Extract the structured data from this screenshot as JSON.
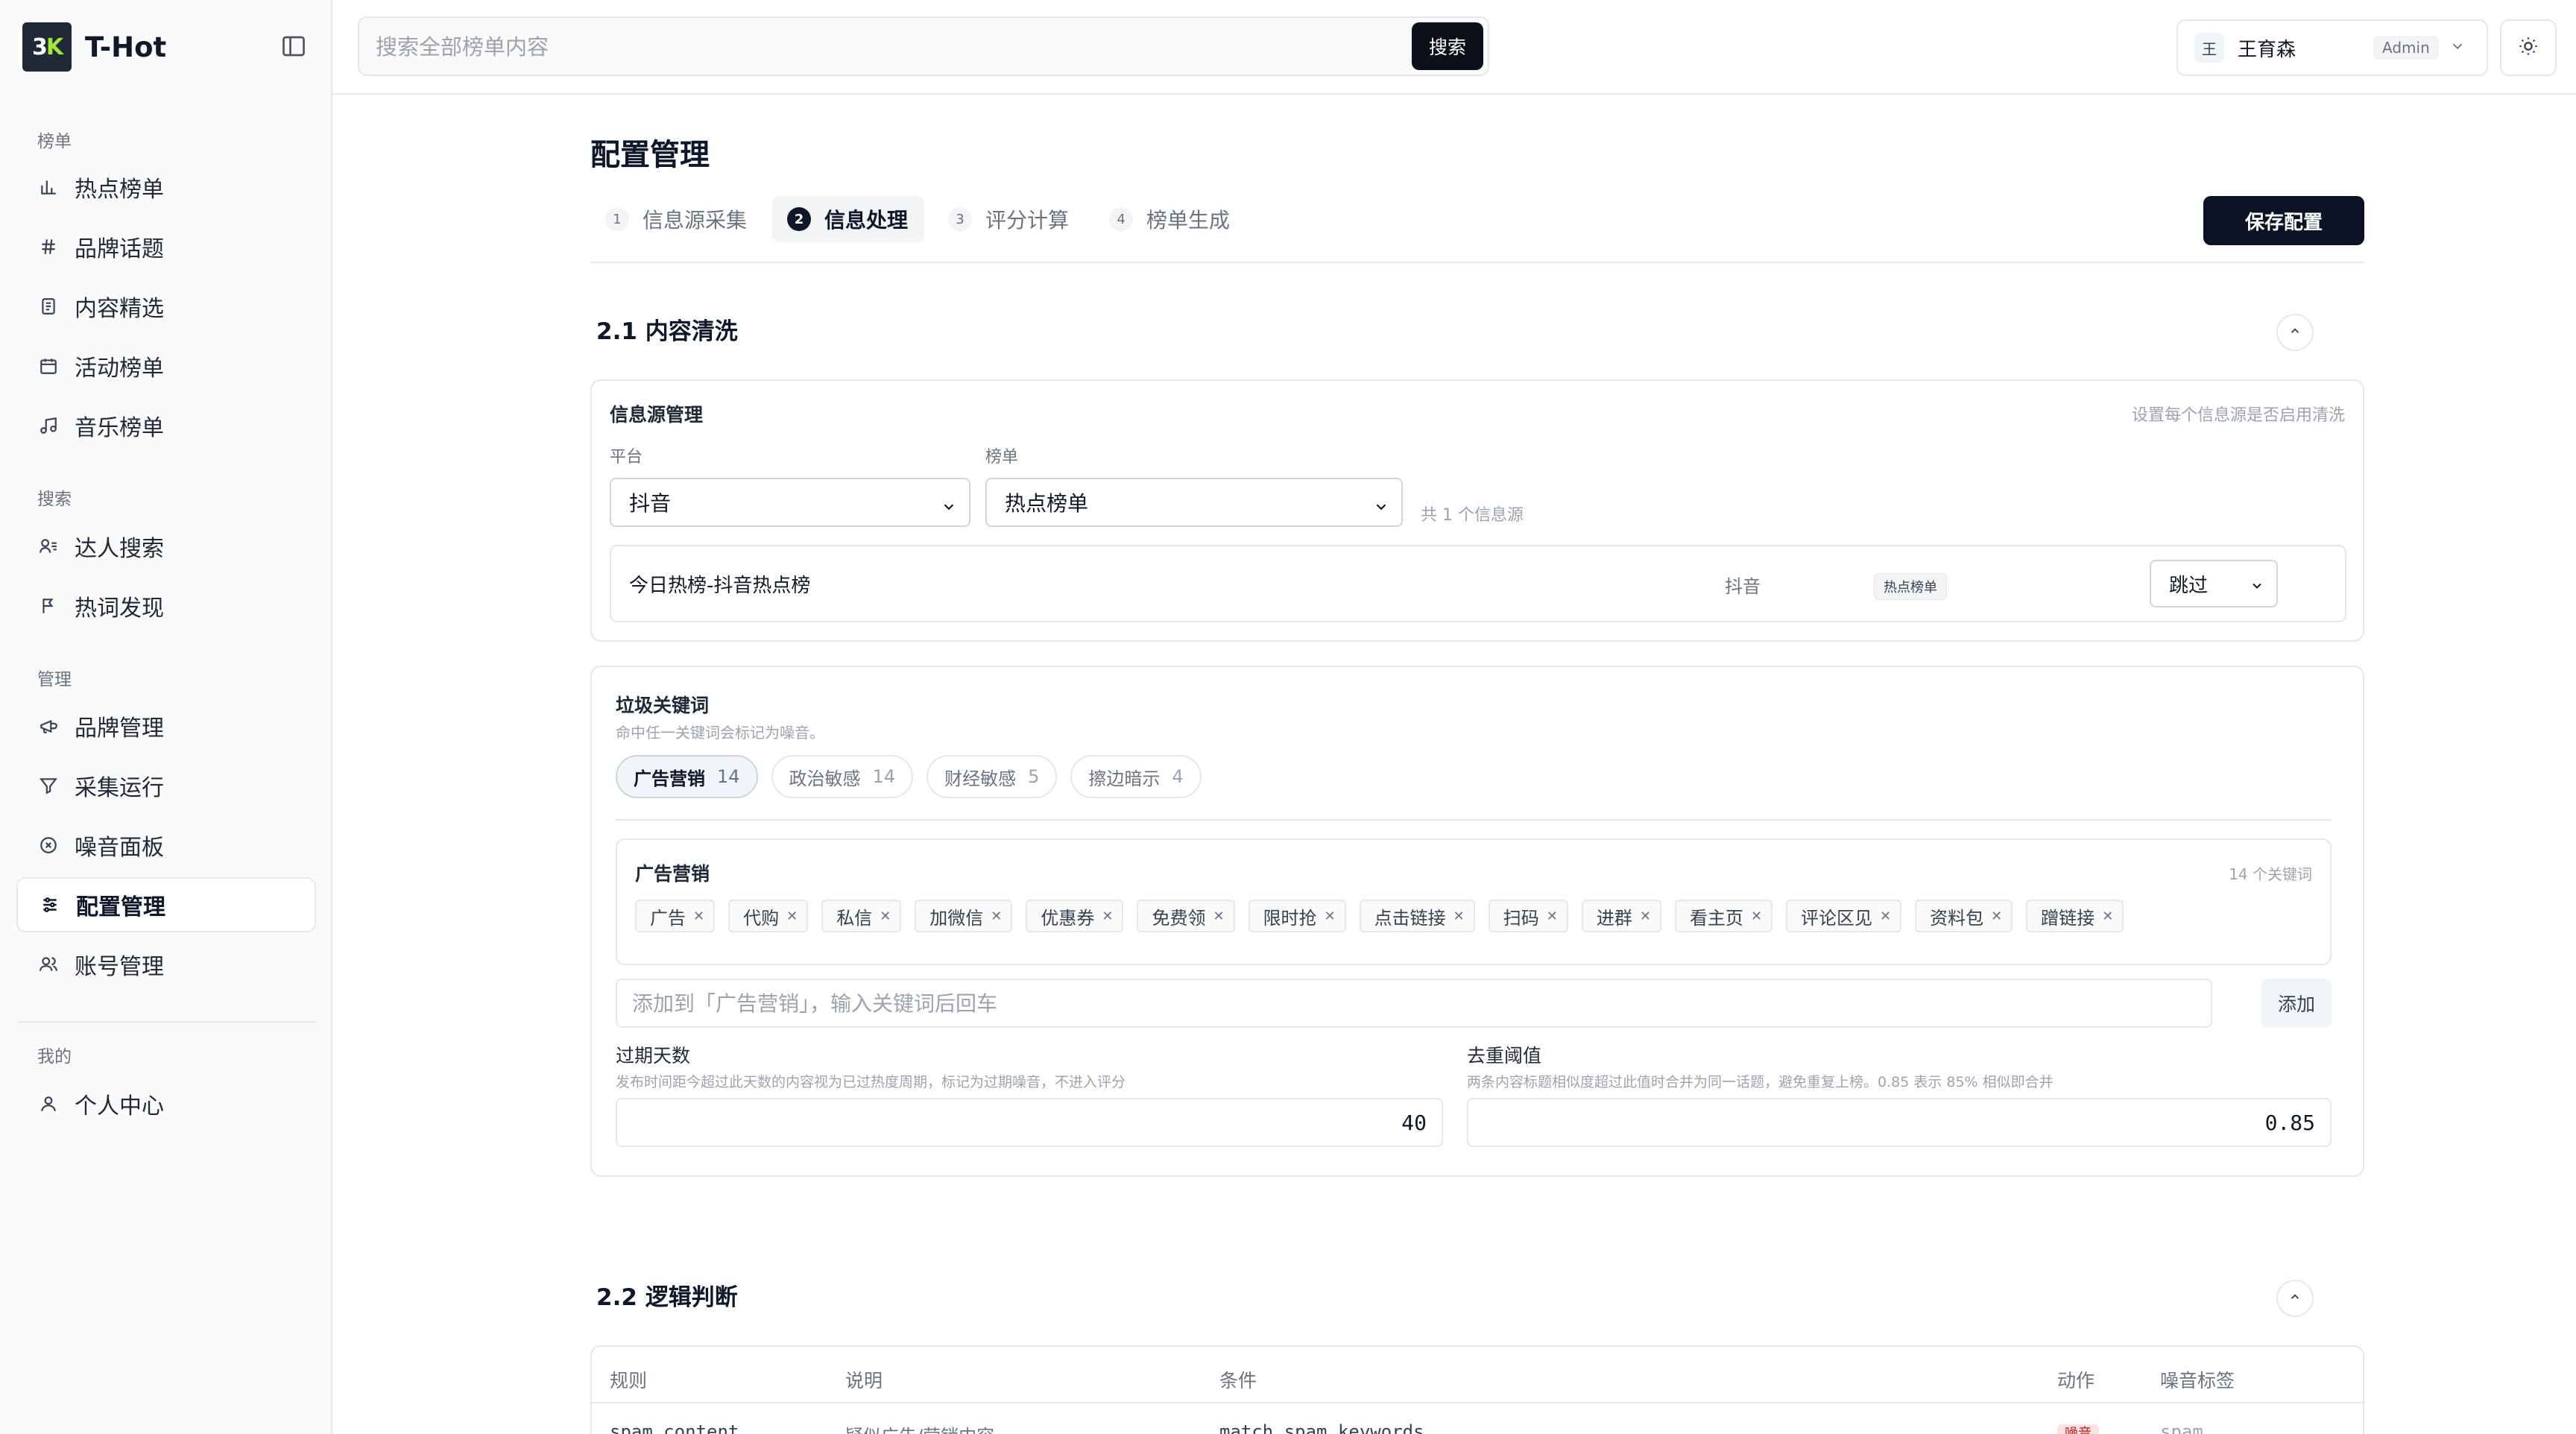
{
  "app": {
    "logo_text": "3K",
    "name": "T-Hot"
  },
  "sidebar": {
    "groups": [
      {
        "title": "榜单",
        "items": [
          {
            "label": "热点榜单",
            "icon": "bar-chart-icon"
          },
          {
            "label": "品牌话题",
            "icon": "hash-icon"
          },
          {
            "label": "内容精选",
            "icon": "document-icon"
          },
          {
            "label": "活动榜单",
            "icon": "calendar-icon"
          },
          {
            "label": "音乐榜单",
            "icon": "music-icon"
          }
        ]
      },
      {
        "title": "搜索",
        "items": [
          {
            "label": "达人搜索",
            "icon": "user-search-icon"
          },
          {
            "label": "热词发现",
            "icon": "discover-icon"
          }
        ]
      },
      {
        "title": "管理",
        "items": [
          {
            "label": "品牌管理",
            "icon": "megaphone-icon"
          },
          {
            "label": "采集运行",
            "icon": "funnel-icon"
          },
          {
            "label": "噪音面板",
            "icon": "noise-icon"
          },
          {
            "label": "配置管理",
            "icon": "sliders-icon",
            "active": true
          },
          {
            "label": "账号管理",
            "icon": "users-icon"
          }
        ]
      },
      {
        "title": "我的",
        "items": [
          {
            "label": "个人中心",
            "icon": "user-icon"
          }
        ]
      }
    ]
  },
  "header": {
    "search_placeholder": "搜索全部榜单内容",
    "search_button": "搜索",
    "user_initial": "王",
    "user_name": "王育森",
    "user_role": "Admin"
  },
  "main": {
    "title": "配置管理",
    "steps": [
      {
        "num": "1",
        "label": "信息源采集"
      },
      {
        "num": "2",
        "label": "信息处理",
        "active": true
      },
      {
        "num": "3",
        "label": "评分计算"
      },
      {
        "num": "4",
        "label": "榜单生成"
      }
    ],
    "save_button": "保存配置",
    "section1": {
      "title": "2.1 内容清洗",
      "source_card": {
        "title": "信息源管理",
        "hint": "设置每个信息源是否启用清洗",
        "platform_label": "平台",
        "platform_value": "抖音",
        "list_label": "榜单",
        "list_value": "热点榜单",
        "count_text": "共 1 个信息源",
        "row": {
          "name": "今日热榜-抖音热点榜",
          "platform": "抖音",
          "tag": "热点榜单",
          "action": "跳过"
        }
      },
      "keyword_card": {
        "title": "垃圾关键词",
        "desc": "命中任一关键词会标记为噪音。",
        "categories": [
          {
            "label": "广告营销",
            "count": "14",
            "active": true
          },
          {
            "label": "政治敏感",
            "count": "14"
          },
          {
            "label": "财经敏感",
            "count": "5"
          },
          {
            "label": "擦边暗示",
            "count": "4"
          }
        ],
        "panel_title": "广告营销",
        "panel_count": "14 个关键词",
        "keywords": [
          "广告",
          "代购",
          "私信",
          "加微信",
          "优惠券",
          "免费领",
          "限时抢",
          "点击链接",
          "扫码",
          "进群",
          "看主页",
          "评论区见",
          "资料包",
          "蹭链接"
        ],
        "add_placeholder": "添加到「广告营销」，输入关键词后回车",
        "add_button": "添加",
        "expire": {
          "label": "过期天数",
          "desc": "发布时间距今超过此天数的内容视为已过热度周期，标记为过期噪音，不进入评分",
          "value": "40"
        },
        "dedup": {
          "label": "去重阈值",
          "desc": "两条内容标题相似度超过此值时合并为同一话题，避免重复上榜。0.85 表示 85% 相似即合并",
          "value": "0.85"
        }
      }
    },
    "section2": {
      "title": "2.2 逻辑判断",
      "columns": [
        "规则",
        "说明",
        "条件",
        "动作",
        "噪音标签"
      ],
      "row": {
        "rule": "spam_content",
        "desc": "疑似广告/营销内容",
        "cond": "match spam_keywords",
        "action": "噪音",
        "label": "spam"
      }
    }
  }
}
